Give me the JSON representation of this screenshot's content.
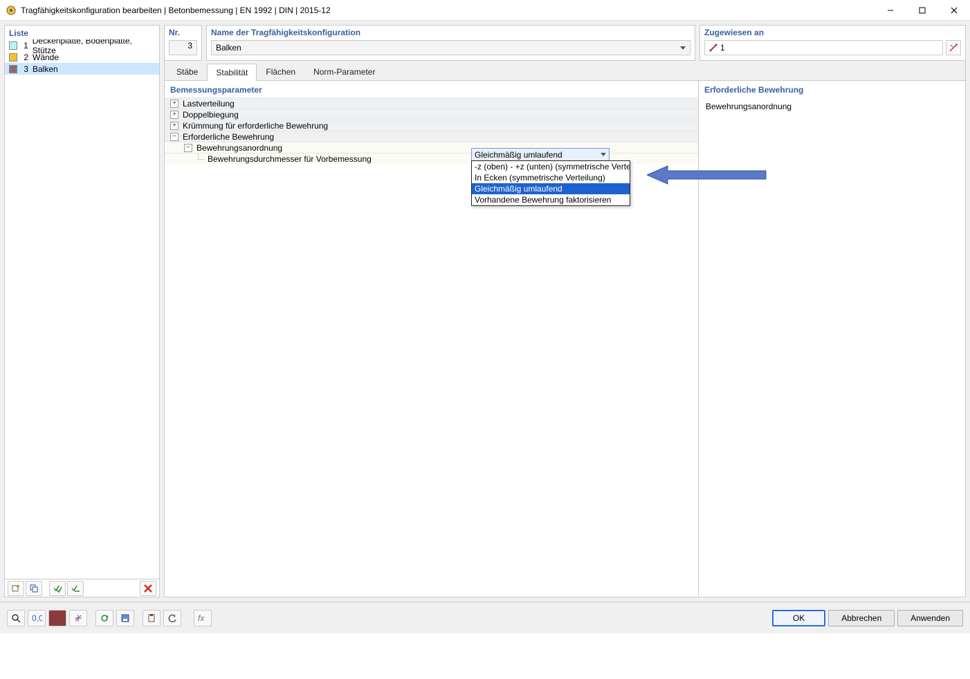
{
  "window": {
    "title": "Tragfähigkeitskonfiguration bearbeiten | Betonbemessung | EN 1992 | DIN | 2015-12"
  },
  "left": {
    "title": "Liste",
    "items": [
      {
        "num": "1",
        "label": "Deckenplatte, Bodenplatte, Stütze",
        "color": "#b9f2ef"
      },
      {
        "num": "2",
        "label": "Wände",
        "color": "#f2c233"
      },
      {
        "num": "3",
        "label": "Balken",
        "color": "#8a6a7a"
      }
    ],
    "selected_index": 2
  },
  "header": {
    "nr_label": "Nr.",
    "nr_value": "3",
    "name_label": "Name der Tragfähigkeitskonfiguration",
    "name_value": "Balken",
    "assigned_label": "Zugewiesen an",
    "assigned_value": "1"
  },
  "tabs": [
    "Stäbe",
    "Stabilität",
    "Flächen",
    "Norm-Parameter"
  ],
  "active_tab": 1,
  "params": {
    "section": "Bemessungsparameter",
    "rows": [
      {
        "label": "Lastverteilung",
        "toggle": "+"
      },
      {
        "label": "Doppelbiegung",
        "toggle": "+"
      },
      {
        "label": "Krümmung für erforderliche Bewehrung",
        "toggle": "+"
      },
      {
        "label": "Erforderliche Bewehrung",
        "toggle": "−"
      }
    ],
    "child1": {
      "label": "Bewehrungsanordnung",
      "toggle": "−"
    },
    "child2": {
      "label": "Bewehrungsdurchmesser für Vorbemessung"
    }
  },
  "dropdown": {
    "selected": "Gleichmäßig umlaufend",
    "options": [
      "-z (oben) - +z (unten) (symmetrische Verteilung)",
      "In Ecken (symmetrische Verteilung)",
      "Gleichmäßig umlaufend",
      "Vorhandene Bewehrung faktorisieren"
    ],
    "highlight_index": 2
  },
  "info": {
    "title": "Erforderliche Bewehrung",
    "line1": "Bewehrungsanordnung"
  },
  "footer": {
    "ok": "OK",
    "cancel": "Abbrechen",
    "apply": "Anwenden"
  }
}
